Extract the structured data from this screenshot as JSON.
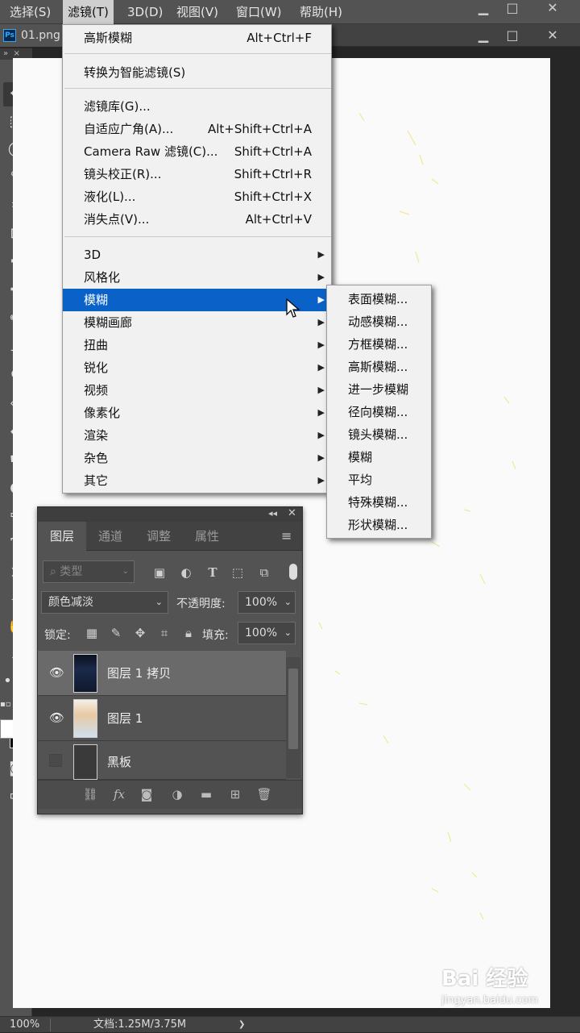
{
  "menubar": {
    "items": [
      "选择(S)",
      "滤镜(T)",
      "3D(D)",
      "视图(V)",
      "窗口(W)",
      "帮助(H)"
    ],
    "active_index": 1
  },
  "document_tab": {
    "name": "01.png"
  },
  "filter_menu": {
    "last_filter": {
      "label": "高斯模糊",
      "shortcut": "Alt+Ctrl+F"
    },
    "smart": {
      "label": "转换为智能滤镜(S)"
    },
    "group2": [
      {
        "label": "滤镜库(G)...",
        "shortcut": ""
      },
      {
        "label": "自适应广角(A)...",
        "shortcut": "Alt+Shift+Ctrl+A"
      },
      {
        "label": "Camera Raw 滤镜(C)...",
        "shortcut": "Shift+Ctrl+A"
      },
      {
        "label": "镜头校正(R)...",
        "shortcut": "Shift+Ctrl+R"
      },
      {
        "label": "液化(L)...",
        "shortcut": "Shift+Ctrl+X"
      },
      {
        "label": "消失点(V)...",
        "shortcut": "Alt+Ctrl+V"
      }
    ],
    "group3": [
      {
        "label": "3D",
        "highlighted": false
      },
      {
        "label": "风格化",
        "highlighted": false
      },
      {
        "label": "模糊",
        "highlighted": true
      },
      {
        "label": "模糊画廊",
        "highlighted": false
      },
      {
        "label": "扭曲",
        "highlighted": false
      },
      {
        "label": "锐化",
        "highlighted": false
      },
      {
        "label": "视频",
        "highlighted": false
      },
      {
        "label": "像素化",
        "highlighted": false
      },
      {
        "label": "渲染",
        "highlighted": false
      },
      {
        "label": "杂色",
        "highlighted": false
      },
      {
        "label": "其它",
        "highlighted": false
      }
    ]
  },
  "blur_submenu": [
    "表面模糊...",
    "动感模糊...",
    "方框模糊...",
    "高斯模糊...",
    "进一步模糊",
    "径向模糊...",
    "镜头模糊...",
    "模糊",
    "平均",
    "特殊模糊...",
    "形状模糊..."
  ],
  "layers_panel": {
    "tabs": [
      "图层",
      "通道",
      "调整",
      "属性"
    ],
    "active_tab": 0,
    "filter_placeholder": "类型",
    "blend_mode": "颜色减淡",
    "opacity_label": "不透明度:",
    "opacity_value": "100%",
    "lock_label": "锁定:",
    "fill_label": "填充:",
    "fill_value": "100%",
    "layers": [
      {
        "name": "图层 1 拷贝",
        "visible": true,
        "selected": true
      },
      {
        "name": "图层 1",
        "visible": true,
        "selected": false
      },
      {
        "name": "黑板",
        "visible": false,
        "selected": false
      }
    ]
  },
  "status": {
    "zoom": "100%",
    "doc_info": "文档:1.25M/3.75M"
  },
  "watermark": {
    "brand": "Bai 经验",
    "url": "jingyan.baidu.com"
  },
  "colors": {
    "accent": "#0a62c9",
    "panel": "#535353",
    "menu_bg": "#f1f1f1"
  }
}
